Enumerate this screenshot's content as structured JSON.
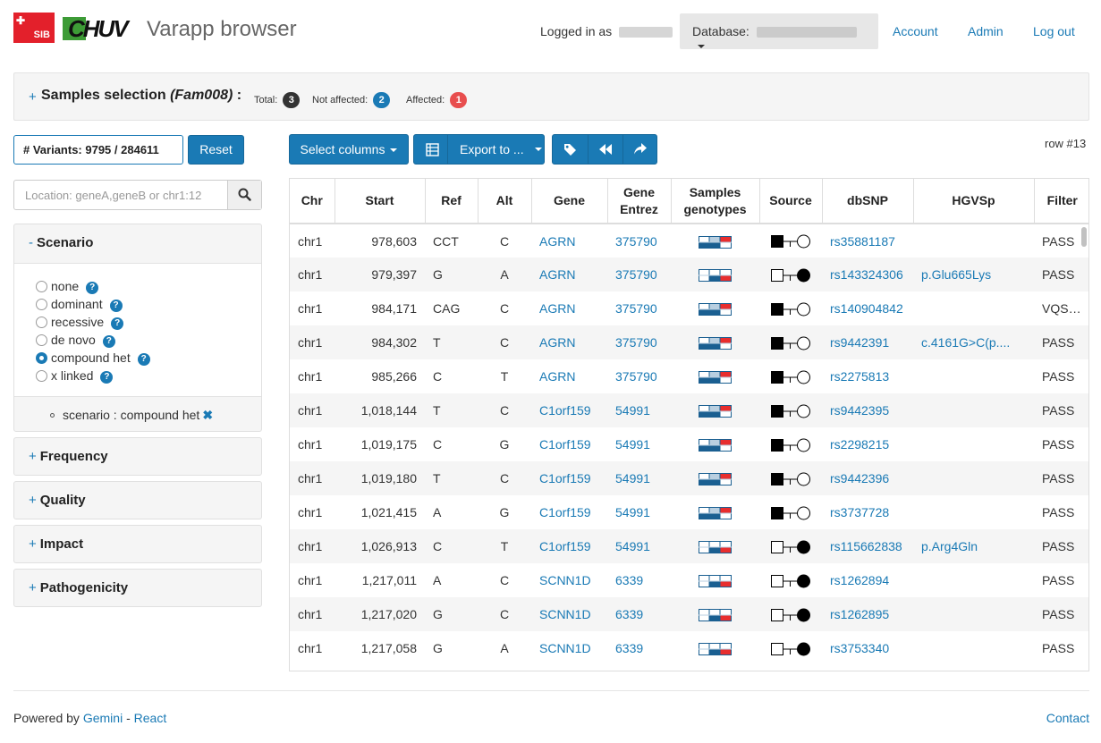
{
  "header": {
    "logo_sib_text": "SIB",
    "logo_chuv_text": "CHUV",
    "app_title": "Varapp browser",
    "logged_in_label": "Logged in as",
    "database_label": "Database:",
    "account_link": "Account",
    "admin_link": "Admin",
    "logout_link": "Log out"
  },
  "samples": {
    "toggle": "+",
    "title": "Samples selection",
    "family": "(Fam008)",
    "colon": ":",
    "total_label": "Total:",
    "total_count": "3",
    "not_affected_label": "Not affected:",
    "not_affected_count": "2",
    "affected_label": "Affected:",
    "affected_count": "1",
    "colors": {
      "total": "#333333",
      "not_affected": "#1a7ab5",
      "affected": "#e84e4e"
    }
  },
  "filters": {
    "variant_count": "# Variants: 9795 / 284611",
    "reset_label": "Reset",
    "location_placeholder": "Location: geneA,geneB or chr1:12",
    "scenario": {
      "toggle": "-",
      "title": "Scenario",
      "options": [
        "none",
        "dominant",
        "recessive",
        "de novo",
        "compound het",
        "x linked"
      ],
      "selected": "compound het",
      "help_glyph": "?",
      "active_filter": "scenario : compound het",
      "remove_glyph": "✖"
    },
    "collapsed_panels": [
      {
        "toggle": "+",
        "title": "Frequency"
      },
      {
        "toggle": "+",
        "title": "Quality"
      },
      {
        "toggle": "+",
        "title": "Impact"
      },
      {
        "toggle": "+",
        "title": "Pathogenicity"
      }
    ]
  },
  "toolbar": {
    "select_columns": "Select columns",
    "export_to": "Export to ...",
    "row_indicator": "row #13"
  },
  "table": {
    "headers": {
      "chr": "Chr",
      "start": "Start",
      "ref": "Ref",
      "alt": "Alt",
      "gene": "Gene",
      "gene_entrez_1": "Gene",
      "gene_entrez_2": "Entrez",
      "samples_1": "Samples",
      "samples_2": "genotypes",
      "source": "Source",
      "dbsnp": "dbSNP",
      "hgvsp": "HGVSp",
      "filter": "Filter"
    },
    "rows": [
      {
        "chr": "chr1",
        "start": "978,603",
        "ref": "CCT",
        "alt": "C",
        "gene": "AGRN",
        "entrez": "375790",
        "geno": "a",
        "source": "paternal",
        "dbsnp": "rs35881187",
        "hgvsp": "",
        "filter": "PASS"
      },
      {
        "chr": "chr1",
        "start": "979,397",
        "ref": "G",
        "alt": "A",
        "gene": "AGRN",
        "entrez": "375790",
        "geno": "b",
        "source": "maternal",
        "dbsnp": "rs143324306",
        "hgvsp": "p.Glu665Lys",
        "filter": "PASS"
      },
      {
        "chr": "chr1",
        "start": "984,171",
        "ref": "CAG",
        "alt": "C",
        "gene": "AGRN",
        "entrez": "375790",
        "geno": "a",
        "source": "paternal",
        "dbsnp": "rs140904842",
        "hgvsp": "",
        "filter": "VQSRTr..."
      },
      {
        "chr": "chr1",
        "start": "984,302",
        "ref": "T",
        "alt": "C",
        "gene": "AGRN",
        "entrez": "375790",
        "geno": "a",
        "source": "paternal",
        "dbsnp": "rs9442391",
        "hgvsp": "c.4161G>C(p....",
        "filter": "PASS"
      },
      {
        "chr": "chr1",
        "start": "985,266",
        "ref": "C",
        "alt": "T",
        "gene": "AGRN",
        "entrez": "375790",
        "geno": "a",
        "source": "paternal",
        "dbsnp": "rs2275813",
        "hgvsp": "",
        "filter": "PASS"
      },
      {
        "chr": "chr1",
        "start": "1,018,144",
        "ref": "T",
        "alt": "C",
        "gene": "C1orf159",
        "entrez": "54991",
        "geno": "a",
        "source": "paternal",
        "dbsnp": "rs9442395",
        "hgvsp": "",
        "filter": "PASS"
      },
      {
        "chr": "chr1",
        "start": "1,019,175",
        "ref": "C",
        "alt": "G",
        "gene": "C1orf159",
        "entrez": "54991",
        "geno": "a",
        "source": "paternal",
        "dbsnp": "rs2298215",
        "hgvsp": "",
        "filter": "PASS"
      },
      {
        "chr": "chr1",
        "start": "1,019,180",
        "ref": "T",
        "alt": "C",
        "gene": "C1orf159",
        "entrez": "54991",
        "geno": "a",
        "source": "paternal",
        "dbsnp": "rs9442396",
        "hgvsp": "",
        "filter": "PASS"
      },
      {
        "chr": "chr1",
        "start": "1,021,415",
        "ref": "A",
        "alt": "G",
        "gene": "C1orf159",
        "entrez": "54991",
        "geno": "a",
        "source": "paternal",
        "dbsnp": "rs3737728",
        "hgvsp": "",
        "filter": "PASS"
      },
      {
        "chr": "chr1",
        "start": "1,026,913",
        "ref": "C",
        "alt": "T",
        "gene": "C1orf159",
        "entrez": "54991",
        "geno": "b",
        "source": "maternal",
        "dbsnp": "rs115662838",
        "hgvsp": "p.Arg4Gln",
        "filter": "PASS"
      },
      {
        "chr": "chr1",
        "start": "1,217,011",
        "ref": "A",
        "alt": "C",
        "gene": "SCNN1D",
        "entrez": "6339",
        "geno": "b",
        "source": "maternal",
        "dbsnp": "rs1262894",
        "hgvsp": "",
        "filter": "PASS"
      },
      {
        "chr": "chr1",
        "start": "1,217,020",
        "ref": "G",
        "alt": "C",
        "gene": "SCNN1D",
        "entrez": "6339",
        "geno": "b",
        "source": "maternal",
        "dbsnp": "rs1262895",
        "hgvsp": "",
        "filter": "PASS"
      },
      {
        "chr": "chr1",
        "start": "1,217,058",
        "ref": "G",
        "alt": "A",
        "gene": "SCNN1D",
        "entrez": "6339",
        "geno": "b",
        "source": "maternal",
        "dbsnp": "rs3753340",
        "hgvsp": "",
        "filter": "PASS"
      }
    ],
    "genotype_colors": {
      "blue": "#1a5f91",
      "red": "#e82e2e",
      "light_blue": "#b9cfe0"
    }
  },
  "footer": {
    "powered_by": "Powered by",
    "gemini": "Gemini",
    "dash": "-",
    "react": "React",
    "contact": "Contact"
  },
  "icons": {
    "search": "search-icon",
    "tag": "tag-icon",
    "rewind": "rewind-icon",
    "share": "share-arrow-icon",
    "table": "table-icon"
  }
}
